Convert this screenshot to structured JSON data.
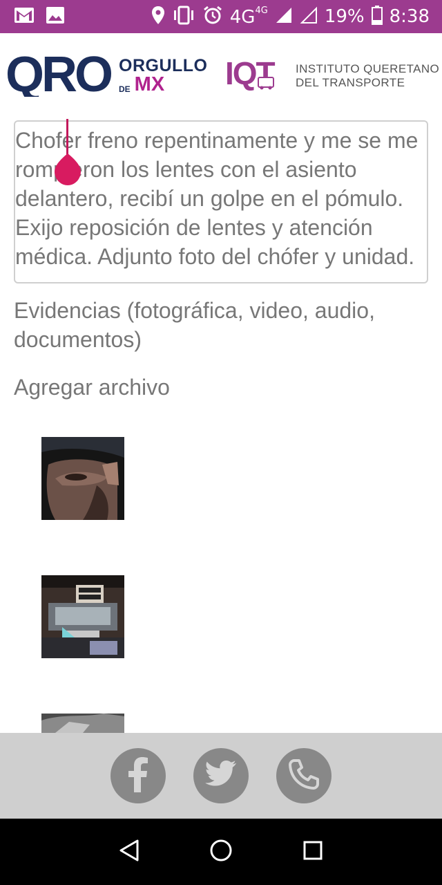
{
  "status_bar": {
    "network": "4G",
    "network_sup": "4G",
    "battery": "19%",
    "time": "8:38",
    "icons": [
      "gmail-icon",
      "image-icon",
      "location-icon",
      "vibrate-icon",
      "alarm-icon",
      "signal-icon",
      "battery-icon"
    ]
  },
  "header": {
    "qro_logo": "QRO",
    "orgullo_top": "ORGULLO",
    "orgullo_de": "DE",
    "orgullo_mx": "MX",
    "iqt_logo": "IQT",
    "iqt_line1": "INSTITUTO QUERETANO",
    "iqt_line2": "DEL TRANSPORTE",
    "brand_colors": {
      "navy": "#1c2e5b",
      "magenta": "#b0238e",
      "purple": "#9c3b8f"
    }
  },
  "form": {
    "complaint_text": "Chofer freno repentinamente y me se me rompieron los lentes con el asiento delantero, recibí un golpe en el pómulo. Exijo reposición de lentes y atención médica. Adjunto foto del chófer y unidad.",
    "evidence_label": "Evidencias (fotográfica, video, audio, documentos)",
    "add_file_label": "Agregar archivo",
    "attachments": [
      "photo-face",
      "photo-bus-plate",
      "photo-partial"
    ]
  },
  "footer": {
    "social": [
      "facebook-icon",
      "twitter-icon",
      "phone-icon"
    ]
  },
  "nav": {
    "buttons": [
      "back-icon",
      "home-icon",
      "recents-icon"
    ]
  }
}
